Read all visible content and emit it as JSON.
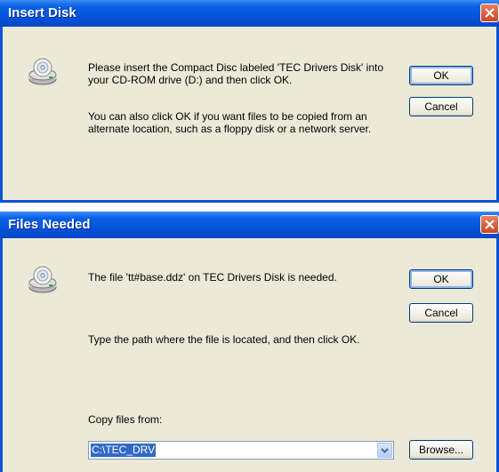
{
  "dialog1": {
    "title": "Insert Disk",
    "message": "Please insert the Compact Disc labeled 'TEC Drivers Disk' into your CD-ROM drive (D:) and then click OK.",
    "hint": "You can also click OK if you want files to be copied from an alternate location, such as a floppy disk or a network server.",
    "ok_label": "OK",
    "cancel_label": "Cancel"
  },
  "dialog2": {
    "title": "Files Needed",
    "message": "The file 'tt#base.ddz' on TEC Drivers Disk is needed.",
    "hint": "Type the path where the file is located, and then click OK.",
    "ok_label": "OK",
    "cancel_label": "Cancel",
    "copy_from_label": "Copy files from:",
    "copy_from_value": "C:\\TEC_DRV",
    "browse_label": "Browse..."
  },
  "icons": {
    "close": "close-icon",
    "cd": "cd-drive-icon",
    "dropdown": "chevron-down-icon"
  },
  "colors": {
    "titlebar": "#0554dc",
    "dialog_bg": "#ece9d8",
    "close": "#cf4421",
    "selection": "#316ac5"
  }
}
